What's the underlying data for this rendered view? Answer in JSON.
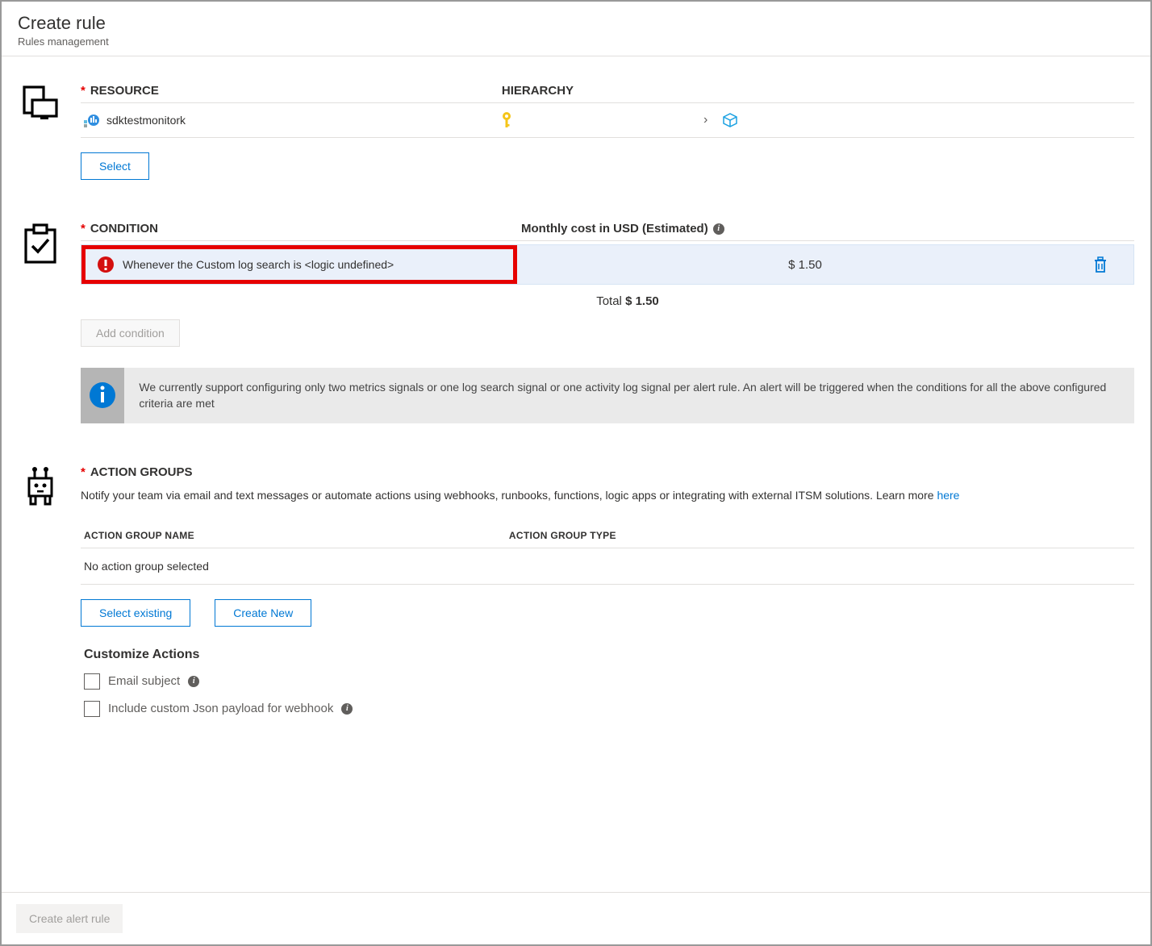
{
  "header": {
    "title": "Create rule",
    "subtitle": "Rules management"
  },
  "resource": {
    "label": "RESOURCE",
    "hierarchy_label": "HIERARCHY",
    "name": "sdktestmonitork",
    "select_btn": "Select"
  },
  "condition": {
    "label": "CONDITION",
    "cost_label": "Monthly cost in USD (Estimated)",
    "row_text": "Whenever the Custom log search is <logic undefined>",
    "row_cost": "$ 1.50",
    "total_label": "Total ",
    "total_value": "$ 1.50",
    "add_btn": "Add condition",
    "info_text": "We currently support configuring only two metrics signals or one log search signal or one activity log signal per alert rule. An alert will be triggered when the conditions for all the above configured criteria are met"
  },
  "action_groups": {
    "label": "ACTION GROUPS",
    "desc_1": "Notify your team via email and text messages or automate actions using webhooks, runbooks, functions, logic apps or integrating with external ITSM solutions. Learn more ",
    "desc_link": "here",
    "col_name": "ACTION GROUP NAME",
    "col_type": "ACTION GROUP TYPE",
    "empty": "No action group selected",
    "select_btn": "Select existing",
    "create_btn": "Create New",
    "customize_title": "Customize Actions",
    "chk_email": "Email subject",
    "chk_webhook": "Include custom Json payload for webhook"
  },
  "footer": {
    "create_btn": "Create alert rule"
  }
}
